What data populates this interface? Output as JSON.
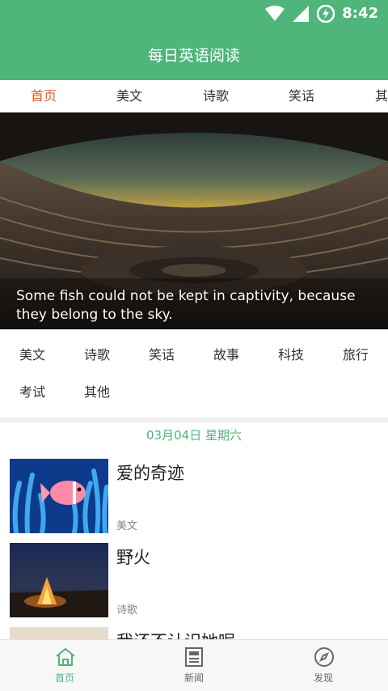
{
  "status_bar": {
    "time": "8:42"
  },
  "app": {
    "title": "每日英语阅读"
  },
  "tabs": [
    {
      "label": "首页"
    },
    {
      "label": "美文"
    },
    {
      "label": "诗歌"
    },
    {
      "label": "笑话"
    },
    {
      "label": "其"
    }
  ],
  "banner": {
    "caption": "Some fish could not be kept in captivity, because they belong to the sky."
  },
  "categories": [
    {
      "label": "美文"
    },
    {
      "label": "诗歌"
    },
    {
      "label": "笑话"
    },
    {
      "label": "故事"
    },
    {
      "label": "科技"
    },
    {
      "label": "旅行"
    },
    {
      "label": "考试"
    },
    {
      "label": "其他"
    }
  ],
  "list": {
    "date": "03月04日 星期六",
    "items": [
      {
        "title": "爱的奇迹",
        "category": "美文",
        "thumb_icon": "clownfish-photo"
      },
      {
        "title": "野火",
        "category": "诗歌",
        "thumb_icon": "campfire-photo"
      },
      {
        "title": "我还不认识她呢",
        "category": "",
        "thumb_icon": "landscape-photo"
      }
    ]
  },
  "bottom_nav": [
    {
      "label": "首页",
      "icon": "home-icon"
    },
    {
      "label": "新闻",
      "icon": "news-icon"
    },
    {
      "label": "发现",
      "icon": "compass-icon"
    }
  ],
  "colors": {
    "primary": "#4fb57b",
    "active_tab": "#e05a2a"
  }
}
